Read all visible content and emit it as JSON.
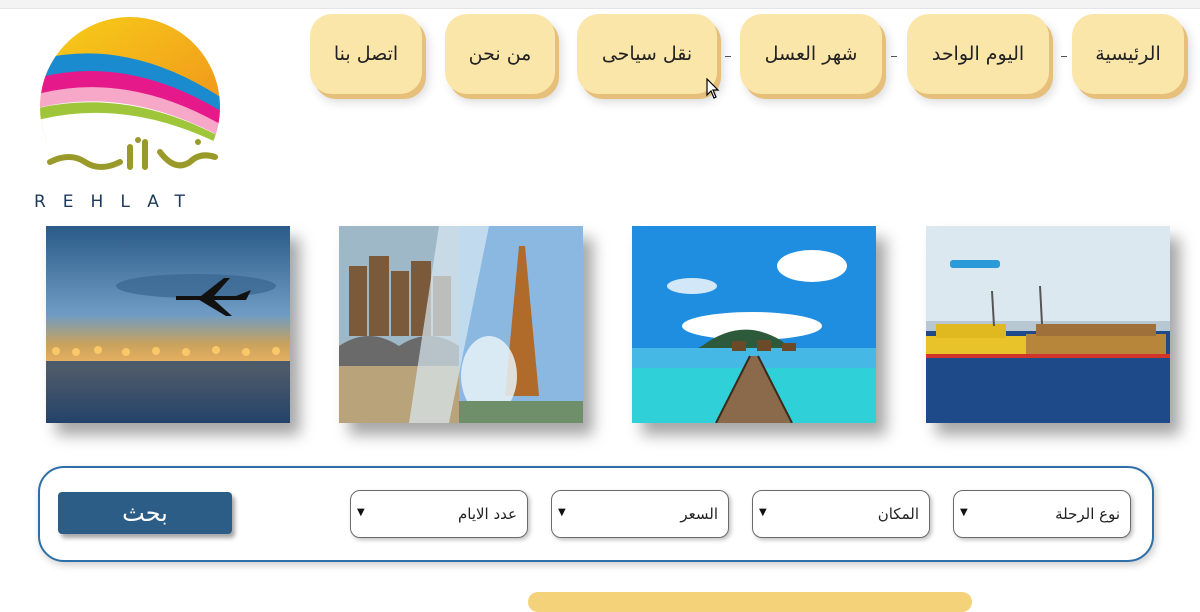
{
  "brand": {
    "name": "REHLAT",
    "arabic_logo_text": "رحلات"
  },
  "nav": {
    "items": [
      {
        "label": "الرئيسية"
      },
      {
        "label": "اليوم الواحد"
      },
      {
        "label": "شهر العسل"
      },
      {
        "label": "نقل سياحى"
      },
      {
        "label": "من نحن"
      },
      {
        "label": "اتصل بنا"
      }
    ]
  },
  "photos": [
    {
      "subject": "airplane at dusk"
    },
    {
      "subject": "amsterdam and eiffel tower collage"
    },
    {
      "subject": "tropical overwater bungalows"
    },
    {
      "subject": "boats at sea"
    }
  ],
  "search": {
    "fields": [
      {
        "label": "نوع الرحلة"
      },
      {
        "label": "المكان"
      },
      {
        "label": "السعر"
      },
      {
        "label": "عدد الايام"
      }
    ],
    "button_label": "بحث"
  },
  "icons": {
    "dropdown": "caret-down-icon",
    "cursor": "mouse-pointer-icon"
  },
  "colors": {
    "nav_bg": "#fbe6aa",
    "accent_blue": "#2c5d86",
    "border_blue": "#2e6fa8"
  }
}
